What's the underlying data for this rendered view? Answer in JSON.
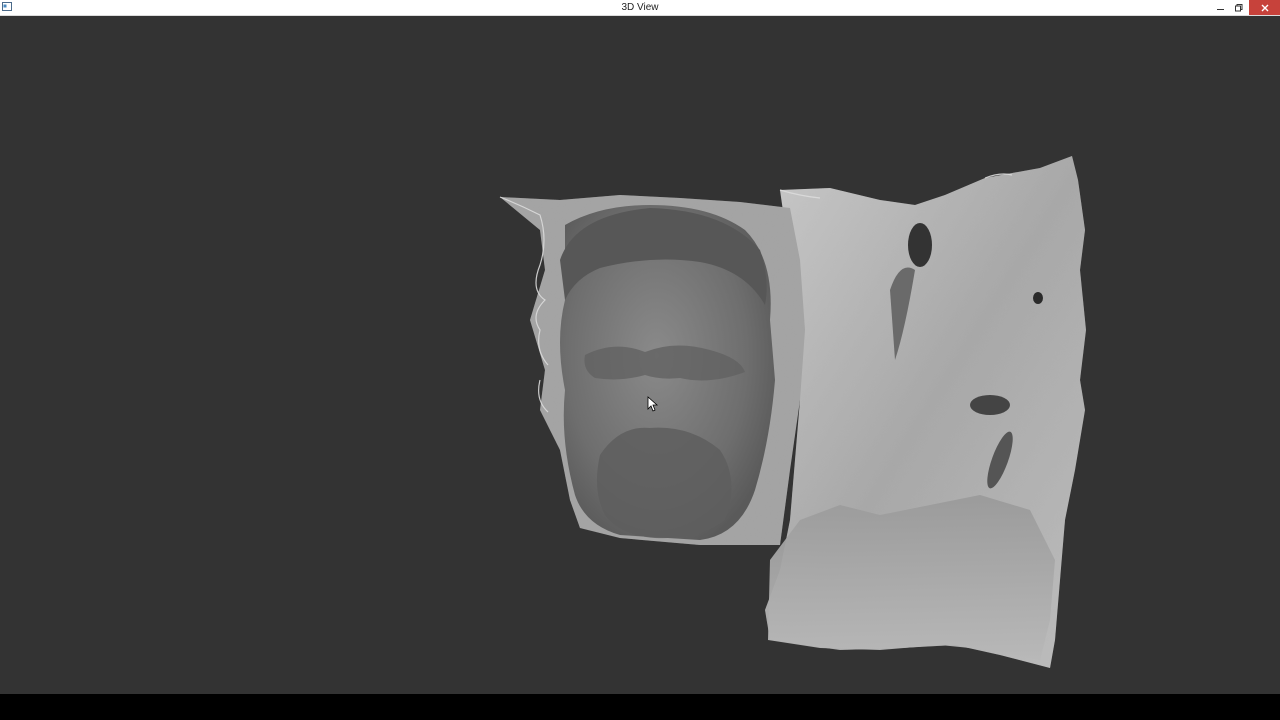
{
  "window": {
    "title": "3D View",
    "controls": {
      "minimize_icon": "minimize-icon",
      "maximize_icon": "restore-icon",
      "close_icon": "close-icon"
    }
  },
  "viewport": {
    "background_color": "#333333",
    "content": "point-cloud-scan"
  },
  "colors": {
    "titlebar": "#ffffff",
    "close_button": "#c7423b",
    "viewport_bg": "#333333"
  }
}
